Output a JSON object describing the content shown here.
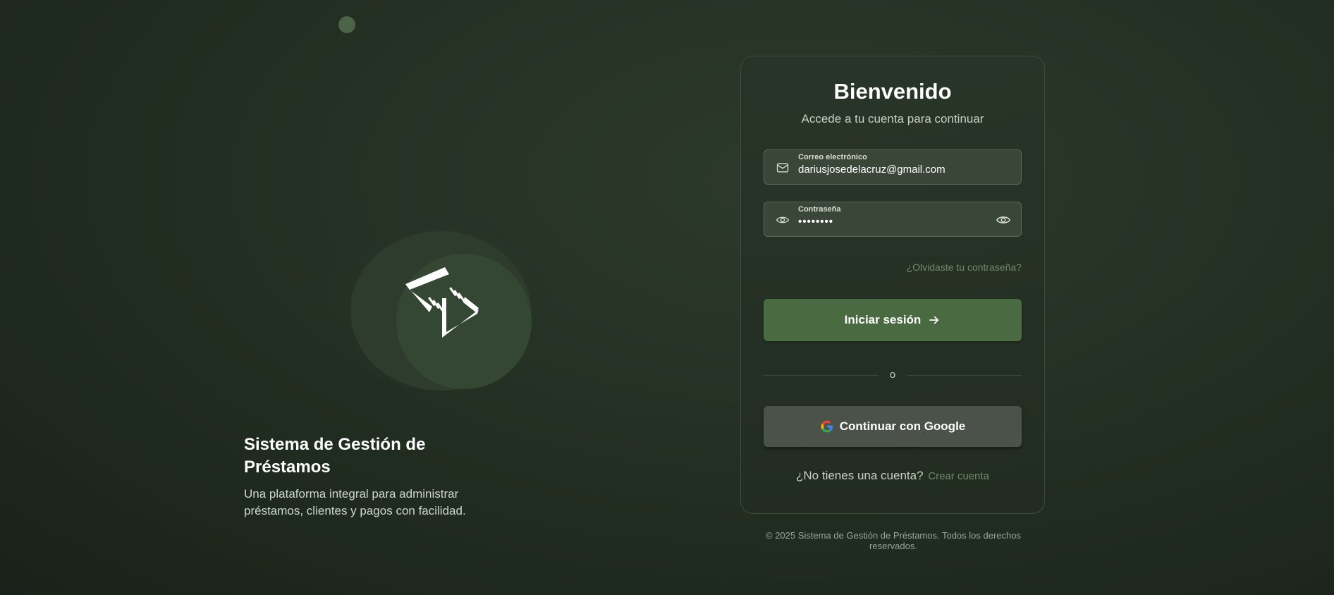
{
  "brand": {
    "title": "Sistema de Gestión de Préstamos",
    "description": "Una plataforma integral para administrar préstamos, clientes y pagos con facilidad."
  },
  "login": {
    "title": "Bienvenido",
    "subtitle": "Accede a tu cuenta para continuar",
    "email": {
      "label": "Correo electrónico",
      "value": "dariusjosedelacruz@gmail.com",
      "icon": "mail-icon"
    },
    "password": {
      "label": "Contraseña",
      "value": "••••••••",
      "icon": "eye-icon",
      "toggle_icon": "eye-icon"
    },
    "forgot_link": "¿Olvidaste tu contraseña?",
    "submit_label": "Iniciar sesión",
    "submit_icon": "arrow-right-icon",
    "divider_text": "o",
    "google_label": "Continuar con Google",
    "google_icon": "google-icon",
    "signup_prompt": "¿No tienes una cuenta?",
    "signup_link": "Crear cuenta"
  },
  "footer": {
    "copyright": "© 2025 Sistema de Gestión de Préstamos. Todos los derechos reservados."
  },
  "colors": {
    "background": "#243023",
    "accent": "#4a6a42",
    "link": "#6f8a69",
    "card_border": "#3f4b3d"
  }
}
